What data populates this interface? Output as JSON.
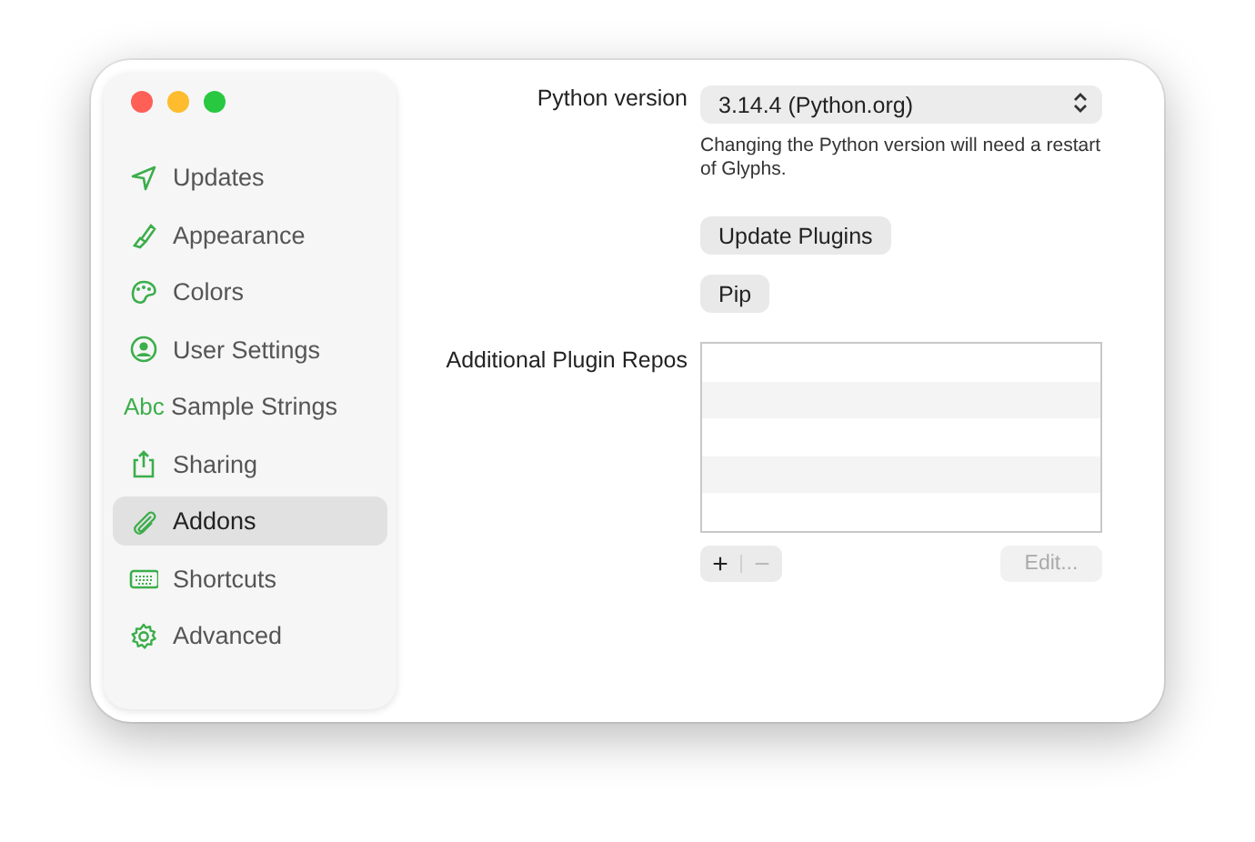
{
  "sidebar": {
    "items": [
      {
        "label": "Updates",
        "selected": false
      },
      {
        "label": "Appearance",
        "selected": false
      },
      {
        "label": "Colors",
        "selected": false
      },
      {
        "label": "User Settings",
        "selected": false
      },
      {
        "label": "Sample Strings",
        "icon_text": "Abc",
        "selected": false
      },
      {
        "label": "Sharing",
        "selected": false
      },
      {
        "label": "Addons",
        "selected": true
      },
      {
        "label": "Shortcuts",
        "selected": false
      },
      {
        "label": "Advanced",
        "selected": false
      }
    ]
  },
  "python_version": {
    "label": "Python version",
    "value": "3.14.4 (Python.org)",
    "note": "Changing the Python version will need a restart of Glyphs."
  },
  "buttons": [
    {
      "label": "Update Plugins"
    },
    {
      "label": "Pip"
    }
  ],
  "plugin_repos": {
    "label": "Additional Plugin Repos",
    "controls": [
      {
        "label": "+",
        "disabled": false
      },
      {
        "label": "−",
        "disabled": true
      }
    ],
    "edit_button": {
      "label": "Edit...",
      "disabled": true
    }
  }
}
